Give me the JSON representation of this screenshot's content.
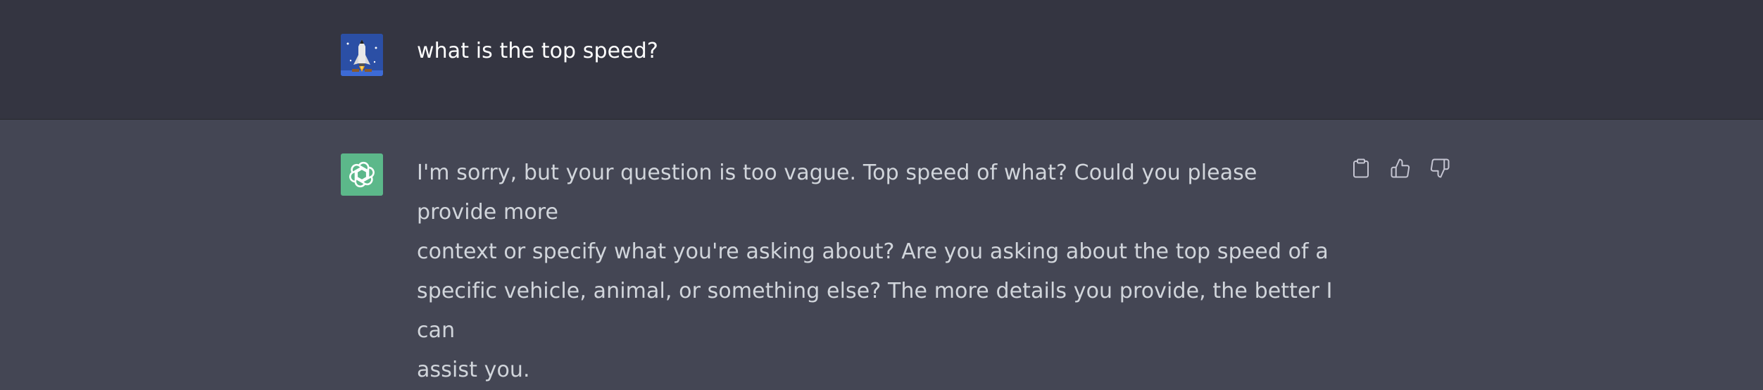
{
  "conversation": {
    "user_message": {
      "avatar_icon": "space-shuttle-icon",
      "text": "what is the top speed?"
    },
    "assistant_message": {
      "avatar_icon": "openai-logo-icon",
      "lines": [
        "I'm sorry, but your question is too vague. Top speed of what? Could you please provide more",
        "context or specify what you're asking about? Are you asking about the top speed of a",
        "specific vehicle, animal, or something else? The more details you provide, the better I can",
        "assist you."
      ],
      "actions": [
        {
          "icon": "clipboard-icon"
        },
        {
          "icon": "thumbs-up-icon"
        },
        {
          "icon": "thumbs-down-icon"
        }
      ]
    }
  },
  "colors": {
    "user_row_bg": "#343541",
    "assistant_row_bg": "#444654",
    "assistant_avatar_bg": "#5cb88a",
    "user_avatar_bg": "#2b4fa5",
    "text": "#d1d5db",
    "icon": "#c5c5d2"
  }
}
